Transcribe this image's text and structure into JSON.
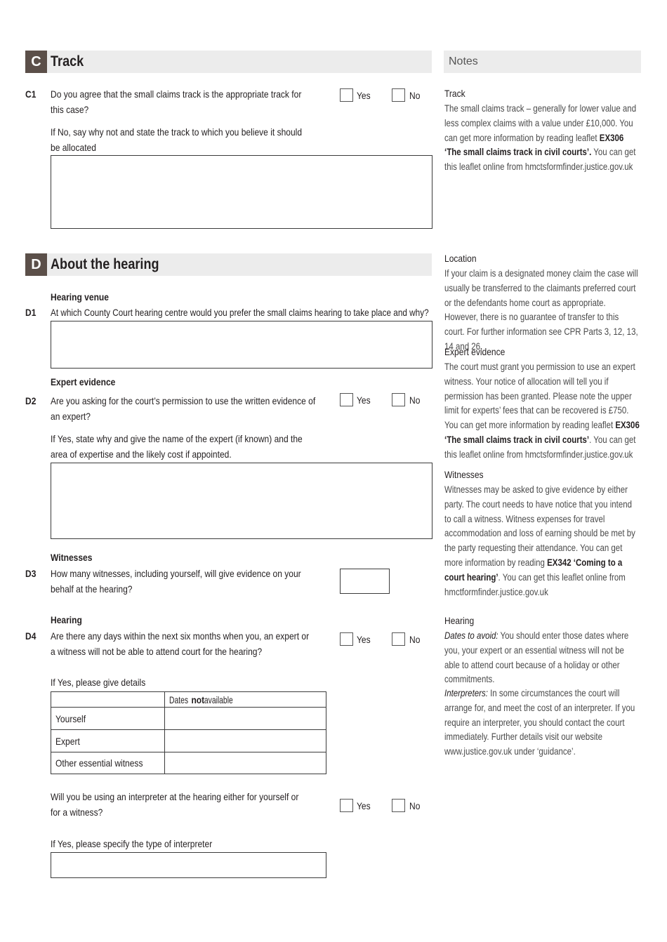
{
  "section_c": {
    "letter": "C",
    "title": "Track",
    "c1": {
      "number": "C1",
      "question_line1": "Do you agree that the small claims track is the appropriate track for",
      "question_line2": "this case?",
      "yes_label": "Yes",
      "no_label": "No",
      "followup_line1": "If No, say why not and state the track to which you believe it should",
      "followup_line2": "be allocated",
      "answer_value": ""
    }
  },
  "notes": {
    "header": "Notes",
    "track": {
      "title": "Track",
      "body_plain_1": "The small claims track – generally for lower value and less complex claims with a value under £10,000. You can get more information by reading leaflet ",
      "body_bold": "EX306 ‘The small claims track in civil courts’.",
      "body_plain_2": " You can get this leaflet online from hmctsformfinder.justice.gov.uk"
    },
    "location": {
      "title": "Location",
      "body": "If your claim is a designated money claim the case will usually be transferred to the claimants preferred court or the defendants home court as appropriate. However, there is no guarantee of transfer to this court. For further information see CPR Parts 3, 12, 13, 14 and 26."
    },
    "expert_evidence": {
      "title": "Expert evidence",
      "body_plain_1": "The court must grant you permission to use an expert witness. Your notice of allocation will tell you if permission has been granted. Please note the upper limit for experts’ fees that can be recovered is £750. You can get more information by reading leaflet ",
      "body_bold": "EX306 ‘The small claims track in civil courts’",
      "body_plain_2": ". You can get this leaflet online from hmctsformfinder.justice.gov.uk"
    },
    "witnesses": {
      "title": "Witnesses",
      "body_plain_1": "Witnesses may be asked to give evidence by either party. The court needs to have notice that you intend to call a witness. Witness expenses for travel accommodation and loss of earning should be met by the party requesting their attendance. You can get more information by reading ",
      "body_bold": "EX342 ‘Coming to a court hearing’",
      "body_plain_2": ". You can get this leaflet online from hmctformfinder.justice.gov.uk"
    },
    "hearing": {
      "title": "Hearing",
      "dates_label": "Dates to avoid:",
      "dates_body": " You should enter those dates where you, your expert or an essential witness will not be able to attend court because of a holiday or other commitments.",
      "interpreters_label": "Interpreters:",
      "interpreters_body": " In some circumstances the court will arrange for, and meet the cost of an interpreter. If you require an interpreter, you should contact the court immediately. Further details visit our website www.justice.gov.uk under ‘guidance’."
    }
  },
  "section_d": {
    "letter": "D",
    "title": "About the hearing",
    "d1": {
      "heading": "Hearing venue",
      "number": "D1",
      "question": "At which County Court hearing centre would you prefer the small claims hearing to take place and why?",
      "answer_value": ""
    },
    "d2": {
      "heading": "Expert evidence",
      "number": "D2",
      "question_line1": "Are you asking for the court’s permission to use the written evidence of",
      "question_line2": "an expert?",
      "yes_label": "Yes",
      "no_label": "No",
      "followup_line1": "If Yes, state why and give the name of the expert (if known) and the",
      "followup_line2": "area of expertise and the likely cost if appointed.",
      "answer_value": ""
    },
    "d3": {
      "heading": "Witnesses",
      "number": "D3",
      "question_line1": "How many witnesses, including yourself, will give evidence on your",
      "question_line2": "behalf at the hearing?",
      "answer_value": ""
    },
    "d4": {
      "heading": "Hearing",
      "number": "D4",
      "question_line1": "Are there any days within the next six months when you, an expert or",
      "question_line2": "a witness will not be able to attend court for the hearing?",
      "yes_label": "Yes",
      "no_label": "No",
      "details_label": "If Yes, please give details",
      "table_header_plain_1": "Dates ",
      "table_header_bold": "not",
      "table_header_plain_2": " available",
      "rows": [
        {
          "label": "Yourself",
          "value": ""
        },
        {
          "label": "Expert",
          "value": ""
        },
        {
          "label": "Other essential witness",
          "value": ""
        }
      ],
      "interpreter_question_line1": "Will you be using an interpreter at the hearing either for yourself or",
      "interpreter_question_line2": "for a witness?",
      "interpreter_yes_label": "Yes",
      "interpreter_no_label": "No",
      "interpreter_type_label": "If Yes, please specify the type of interpreter",
      "interpreter_type_value": ""
    }
  }
}
